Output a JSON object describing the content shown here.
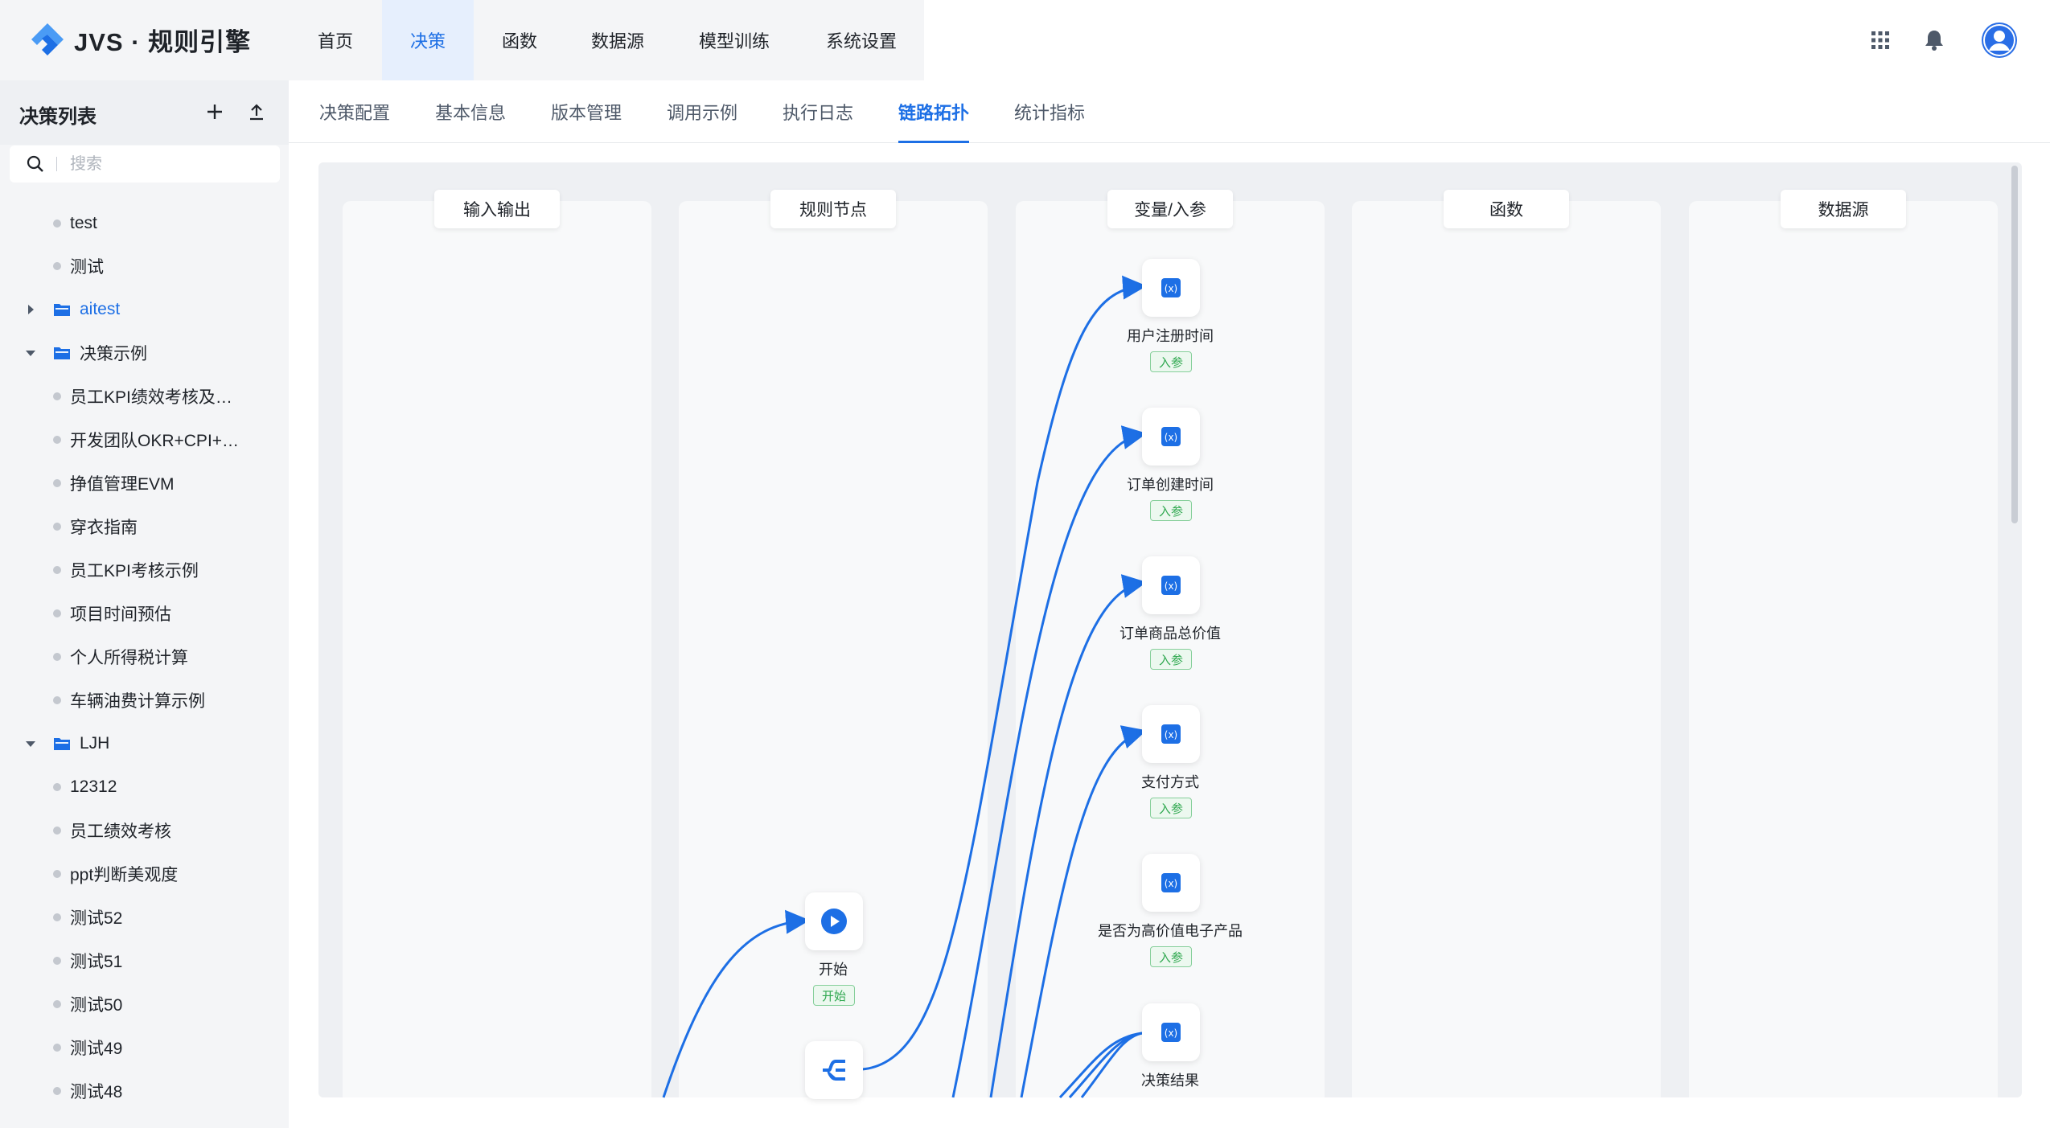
{
  "brand": {
    "name": "JVS · 规则引擎"
  },
  "topnav": {
    "items": [
      {
        "label": "首页"
      },
      {
        "label": "决策"
      },
      {
        "label": "函数"
      },
      {
        "label": "数据源"
      },
      {
        "label": "模型训练"
      },
      {
        "label": "系统设置"
      }
    ],
    "active": "决策"
  },
  "sidebar": {
    "title": "决策列表",
    "search_placeholder": "搜索",
    "items": [
      {
        "label": "test"
      },
      {
        "label": "测试"
      },
      {
        "label": "aitest"
      },
      {
        "label": "决策示例"
      },
      {
        "label": "员工KPI绩效考核及…"
      },
      {
        "label": "开发团队OKR+CPI+…"
      },
      {
        "label": "挣值管理EVM"
      },
      {
        "label": "穿衣指南"
      },
      {
        "label": "员工KPI考核示例"
      },
      {
        "label": "项目时间预估"
      },
      {
        "label": "个人所得税计算"
      },
      {
        "label": "车辆油费计算示例"
      },
      {
        "label": "LJH"
      },
      {
        "label": "12312"
      },
      {
        "label": "员工绩效考核"
      },
      {
        "label": "ppt判断美观度"
      },
      {
        "label": "测试52"
      },
      {
        "label": "测试51"
      },
      {
        "label": "测试50"
      },
      {
        "label": "测试49"
      },
      {
        "label": "测试48"
      }
    ]
  },
  "subtabs": {
    "items": [
      {
        "label": "决策配置"
      },
      {
        "label": "基本信息"
      },
      {
        "label": "版本管理"
      },
      {
        "label": "调用示例"
      },
      {
        "label": "执行日志"
      },
      {
        "label": "链路拓扑"
      },
      {
        "label": "统计指标"
      }
    ],
    "active": "链路拓扑"
  },
  "topology": {
    "columns": [
      {
        "title": "输入输出"
      },
      {
        "title": "规则节点"
      },
      {
        "title": "变量/入参"
      },
      {
        "title": "函数"
      },
      {
        "title": "数据源"
      }
    ],
    "rule_nodes": [
      {
        "label": "开始",
        "tag": "开始",
        "icon": "play-icon"
      },
      {
        "label": "",
        "tag": "",
        "icon": "branch-icon"
      }
    ],
    "variables": [
      {
        "label": "用户注册时间",
        "tag": "入参",
        "icon": "variable-icon"
      },
      {
        "label": "订单创建时间",
        "tag": "入参",
        "icon": "variable-icon"
      },
      {
        "label": "订单商品总价值",
        "tag": "入参",
        "icon": "variable-icon"
      },
      {
        "label": "支付方式",
        "tag": "入参",
        "icon": "variable-icon"
      },
      {
        "label": "是否为高价值电子产品",
        "tag": "入参",
        "icon": "variable-icon"
      },
      {
        "label": "决策结果",
        "tag": "",
        "icon": "variable-icon"
      }
    ],
    "colors": {
      "accent": "#1d6fe5",
      "tag_green": "#2fa84f",
      "link": "#1d6fe5"
    }
  }
}
